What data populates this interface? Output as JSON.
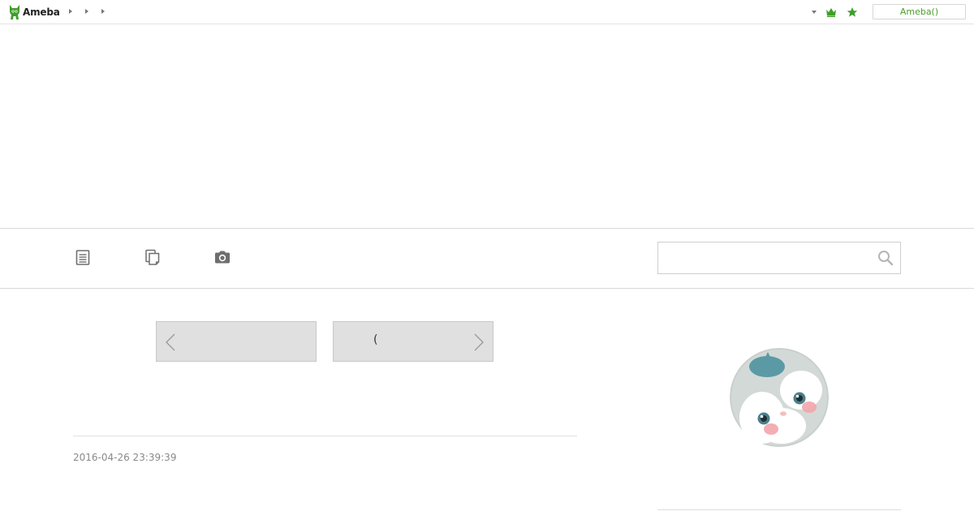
{
  "header": {
    "logo_text": "Ameba",
    "account_button": "Ameba()",
    "accent_color": "#3f9e2a"
  },
  "icons": {
    "logo": "ameba-logo-icon",
    "crown": "crown-icon",
    "star": "star-icon",
    "menu": "dropdown-arrow-icon",
    "nav": [
      "entries-list-icon",
      "themes-copy-icon",
      "camera-icon"
    ],
    "search": "search-icon"
  },
  "search": {
    "value": "",
    "placeholder": ""
  },
  "pager": {
    "prev_label": "",
    "next_label": "("
  },
  "entry": {
    "date": "2016-04-26 23:39:39"
  }
}
